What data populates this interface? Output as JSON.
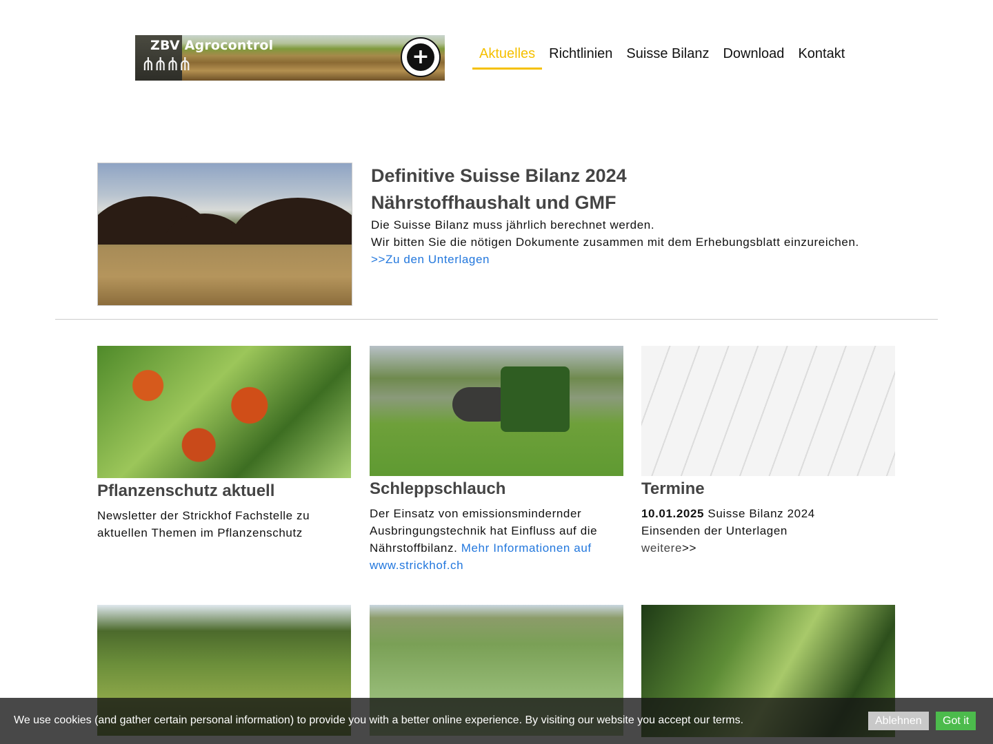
{
  "header": {
    "logo_text": "ZBV Agrocontrol",
    "nav": [
      {
        "label": "Aktuelles",
        "active": true
      },
      {
        "label": "Richtlinien"
      },
      {
        "label": "Suisse Bilanz"
      },
      {
        "label": "Download"
      },
      {
        "label": "Kontakt"
      }
    ]
  },
  "feature": {
    "title_line1": "Definitive Suisse Bilanz 2024",
    "title_line2": "Nährstoffhaushalt und GMF",
    "text_line1": "Die Suisse Bilanz muss jährlich berechnet werden.",
    "text_line2": "Wir bitten Sie die nötigen Dokumente zusammen mit dem Erhebungsblatt einzureichen.",
    "link": ">>Zu den Unterlagen"
  },
  "cards": [
    {
      "title": "Pflanzenschutz aktuell",
      "text": "Newsletter der Strickhof Fachstelle zu aktuellen Themen im Pflanzenschutz"
    },
    {
      "title": "Schleppschlauch",
      "text": "Der Einsatz von emissionsmindernder Ausbringungstechnik hat Einfluss auf die Nährstoffbilanz.",
      "link": "Mehr Informationen auf www.strickhof.ch"
    },
    {
      "title": "Termine",
      "date": "10.01.2025",
      "event": "Suisse Bilanz 2024",
      "text": "Einsenden der Unterlagen",
      "more": "weitere",
      "more_arrows": ">>"
    }
  ],
  "cookie": {
    "message": "We use cookies (and gather certain personal information) to provide you with a better online experience. By visiting our website you accept our terms.",
    "deny": "Ablehnen",
    "accept": "Got it"
  },
  "colors": {
    "accent": "#f5c000",
    "link": "#2277dd",
    "accept_button": "#4cbb4c"
  }
}
